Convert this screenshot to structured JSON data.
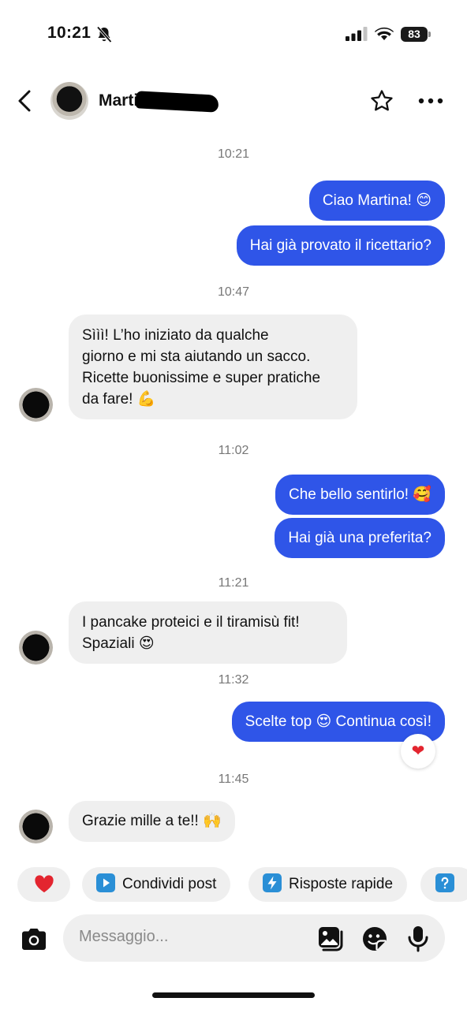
{
  "status_bar": {
    "time": "10:21",
    "battery": "83"
  },
  "header": {
    "contact_name": "Marti"
  },
  "composer": {
    "placeholder": "Messaggio..."
  },
  "quick_replies": [
    {
      "label": "Condividi post",
      "icon": "play-icon"
    },
    {
      "label": "Risposte rapide",
      "icon": "lightning-icon"
    }
  ],
  "thread": [
    {
      "type": "timestamp",
      "text": "10:21"
    },
    {
      "type": "sent",
      "text": "Ciao Martina! 😊"
    },
    {
      "type": "sent",
      "text": "Hai già provato il ricettario?"
    },
    {
      "type": "timestamp",
      "text": "10:47"
    },
    {
      "type": "received",
      "lines": [
        "Sììì! L’ho iniziato da qualche",
        "giorno e mi sta aiutando un sacco.",
        "Ricette buonissime e super pratiche",
        "da fare! 💪"
      ]
    },
    {
      "type": "timestamp",
      "text": "11:02"
    },
    {
      "type": "sent",
      "text": "Che bello sentirlo! 🥰"
    },
    {
      "type": "sent",
      "text": "Hai già una preferita?"
    },
    {
      "type": "timestamp",
      "text": "11:21"
    },
    {
      "type": "received",
      "lines": [
        "I pancake proteici e il tiramisù fit!",
        "Spaziali 😍"
      ]
    },
    {
      "type": "timestamp",
      "text": "11:32"
    },
    {
      "type": "sent",
      "text": "Scelte top 😍 Continua così!",
      "reaction": "❤"
    },
    {
      "type": "timestamp",
      "text": "11:45"
    },
    {
      "type": "received",
      "text": "Grazie mille a te!! 🙌"
    }
  ],
  "colors": {
    "sent_bubble": "#2f55e8",
    "received_bubble": "#efefef",
    "heart": "#e3252f"
  }
}
